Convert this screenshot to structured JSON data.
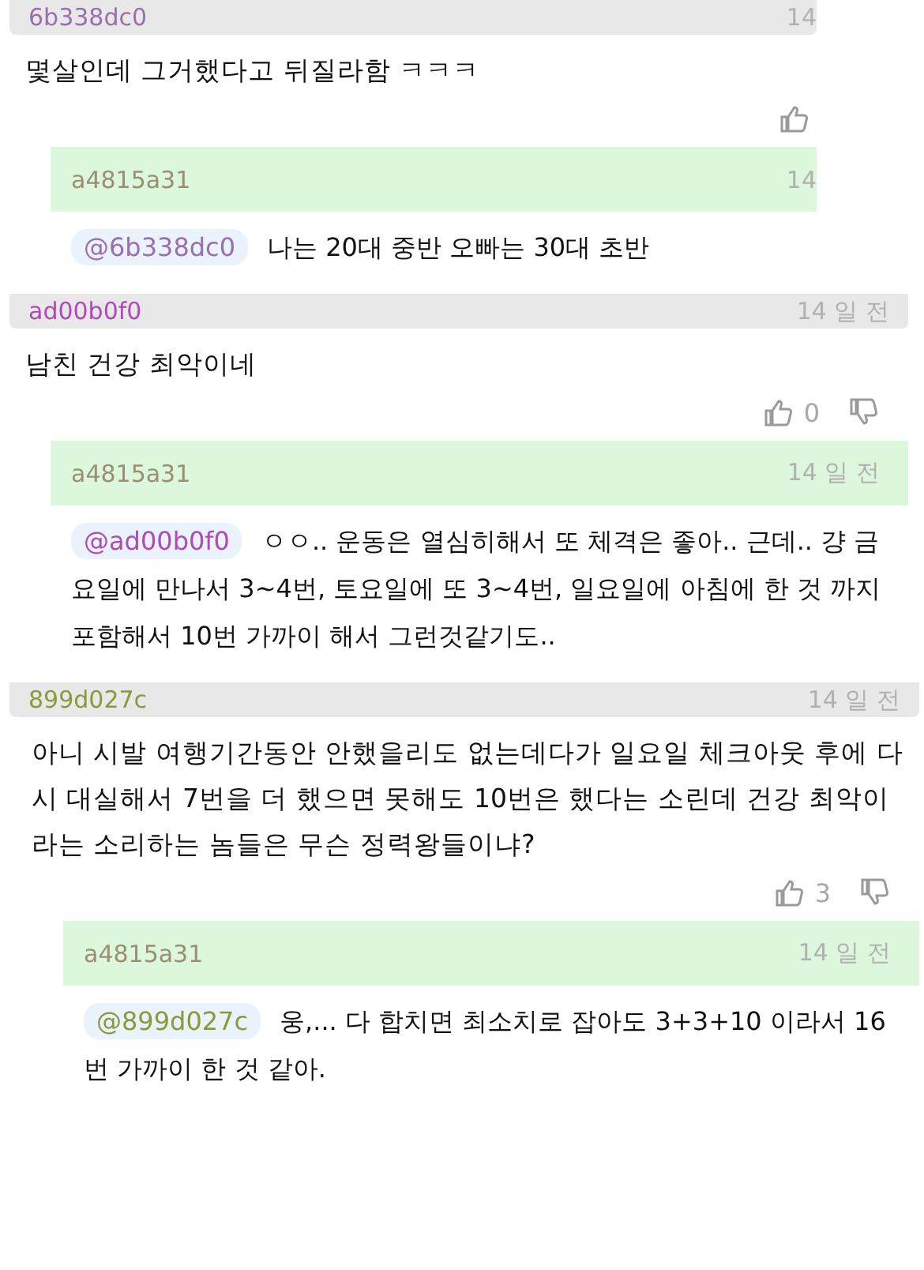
{
  "threads": [
    {
      "comment": {
        "author": "6b338dc0",
        "color": "#9a6fb0",
        "time": "14",
        "text": "몇살인데 그거했다고 뒤질라함 ㅋㅋㅋ",
        "dislike": false
      },
      "reply": {
        "author": "a4815a31",
        "time": "14",
        "mention": "@6b338dc0",
        "text": "나는 20대 중반 오빠는 30대 초반"
      }
    },
    {
      "comment": {
        "author": "ad00b0f0",
        "color": "#b04ab8",
        "time": "14 일 전",
        "text": "남친 건강 최악이네",
        "likes": "0",
        "dislike": true
      },
      "reply": {
        "author": "a4815a31",
        "time": "14 일 전",
        "mention": "@ad00b0f0",
        "text": "ㅇㅇ.. 운동은 열심히해서 또 체격은 좋아.. 근데.. 걍 금요일에 만나서 3~4번, 토요일에 또 3~4번, 일요일에 아침에 한 것 까지 포함해서 10번 가까이 해서 그런것같기도.."
      }
    },
    {
      "comment": {
        "author": "899d027c",
        "color": "#8a9a3a",
        "time": "14 일 전",
        "text": "아니 시발 여행기간동안 안했을리도 없는데다가 일요일 체크아웃 후에 다시 대실해서 7번을 더 했으면 못해도 10번은 했다는 소린데 건강 최악이라는 소리하는 놈들은 무슨 정력왕들이냐?",
        "likes": "3",
        "dislike": true
      },
      "reply": {
        "author": "a4815a31",
        "time": "14 일 전",
        "mention": "@899d027c",
        "text": "웅,... 다 합치면 최소치로 잡아도 3+3+10 이라서 16번 가까이 한 것 같아."
      }
    }
  ]
}
